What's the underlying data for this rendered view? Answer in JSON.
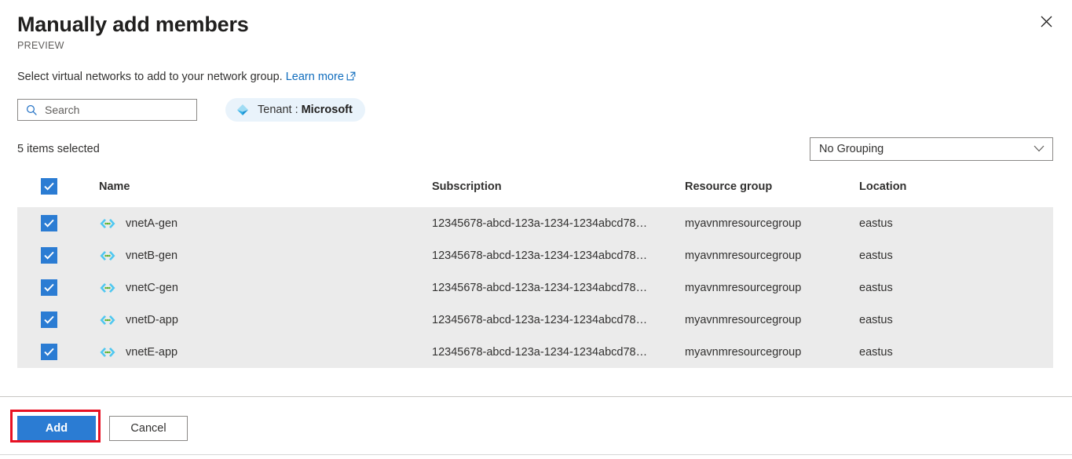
{
  "header": {
    "title": "Manually add members",
    "preview_badge": "PREVIEW",
    "close_icon": "close-icon"
  },
  "description": {
    "text": "Select virtual networks to add to your network group.",
    "link_label": "Learn more",
    "link_icon": "external-link-icon"
  },
  "search": {
    "placeholder": "Search",
    "value": "",
    "icon": "search-icon"
  },
  "tenant_filter": {
    "icon": "azure-ad-tenant-icon",
    "label": "Tenant :",
    "value": "Microsoft"
  },
  "toolbar": {
    "selection_status": "5 items selected",
    "grouping": {
      "selected": "No Grouping",
      "chevron_icon": "chevron-down-icon",
      "options": [
        "No Grouping"
      ]
    }
  },
  "table": {
    "select_all_checked": true,
    "columns": [
      "Name",
      "Subscription",
      "Resource group",
      "Location"
    ],
    "rows": [
      {
        "checked": true,
        "icon": "virtual-network-icon",
        "name": "vnetA-gen",
        "subscription": "12345678-abcd-123a-1234-1234abcd78…",
        "resource_group": "myavnmresourcegroup",
        "location": "eastus"
      },
      {
        "checked": true,
        "icon": "virtual-network-icon",
        "name": "vnetB-gen",
        "subscription": "12345678-abcd-123a-1234-1234abcd78…",
        "resource_group": "myavnmresourcegroup",
        "location": "eastus"
      },
      {
        "checked": true,
        "icon": "virtual-network-icon",
        "name": "vnetC-gen",
        "subscription": "12345678-abcd-123a-1234-1234abcd78…",
        "resource_group": "myavnmresourcegroup",
        "location": "eastus"
      },
      {
        "checked": true,
        "icon": "virtual-network-icon",
        "name": "vnetD-app",
        "subscription": "12345678-abcd-123a-1234-1234abcd78…",
        "resource_group": "myavnmresourcegroup",
        "location": "eastus"
      },
      {
        "checked": true,
        "icon": "virtual-network-icon",
        "name": "vnetE-app",
        "subscription": "12345678-abcd-123a-1234-1234abcd78…",
        "resource_group": "myavnmresourcegroup",
        "location": "eastus"
      }
    ]
  },
  "footer": {
    "add_label": "Add",
    "cancel_label": "Cancel"
  },
  "colors": {
    "accent_blue": "#2b7cd3",
    "link_blue": "#0f6cbd",
    "row_selected_bg": "#ebebeb",
    "pill_bg": "#e9f3fb",
    "highlight_red": "#e81123"
  }
}
